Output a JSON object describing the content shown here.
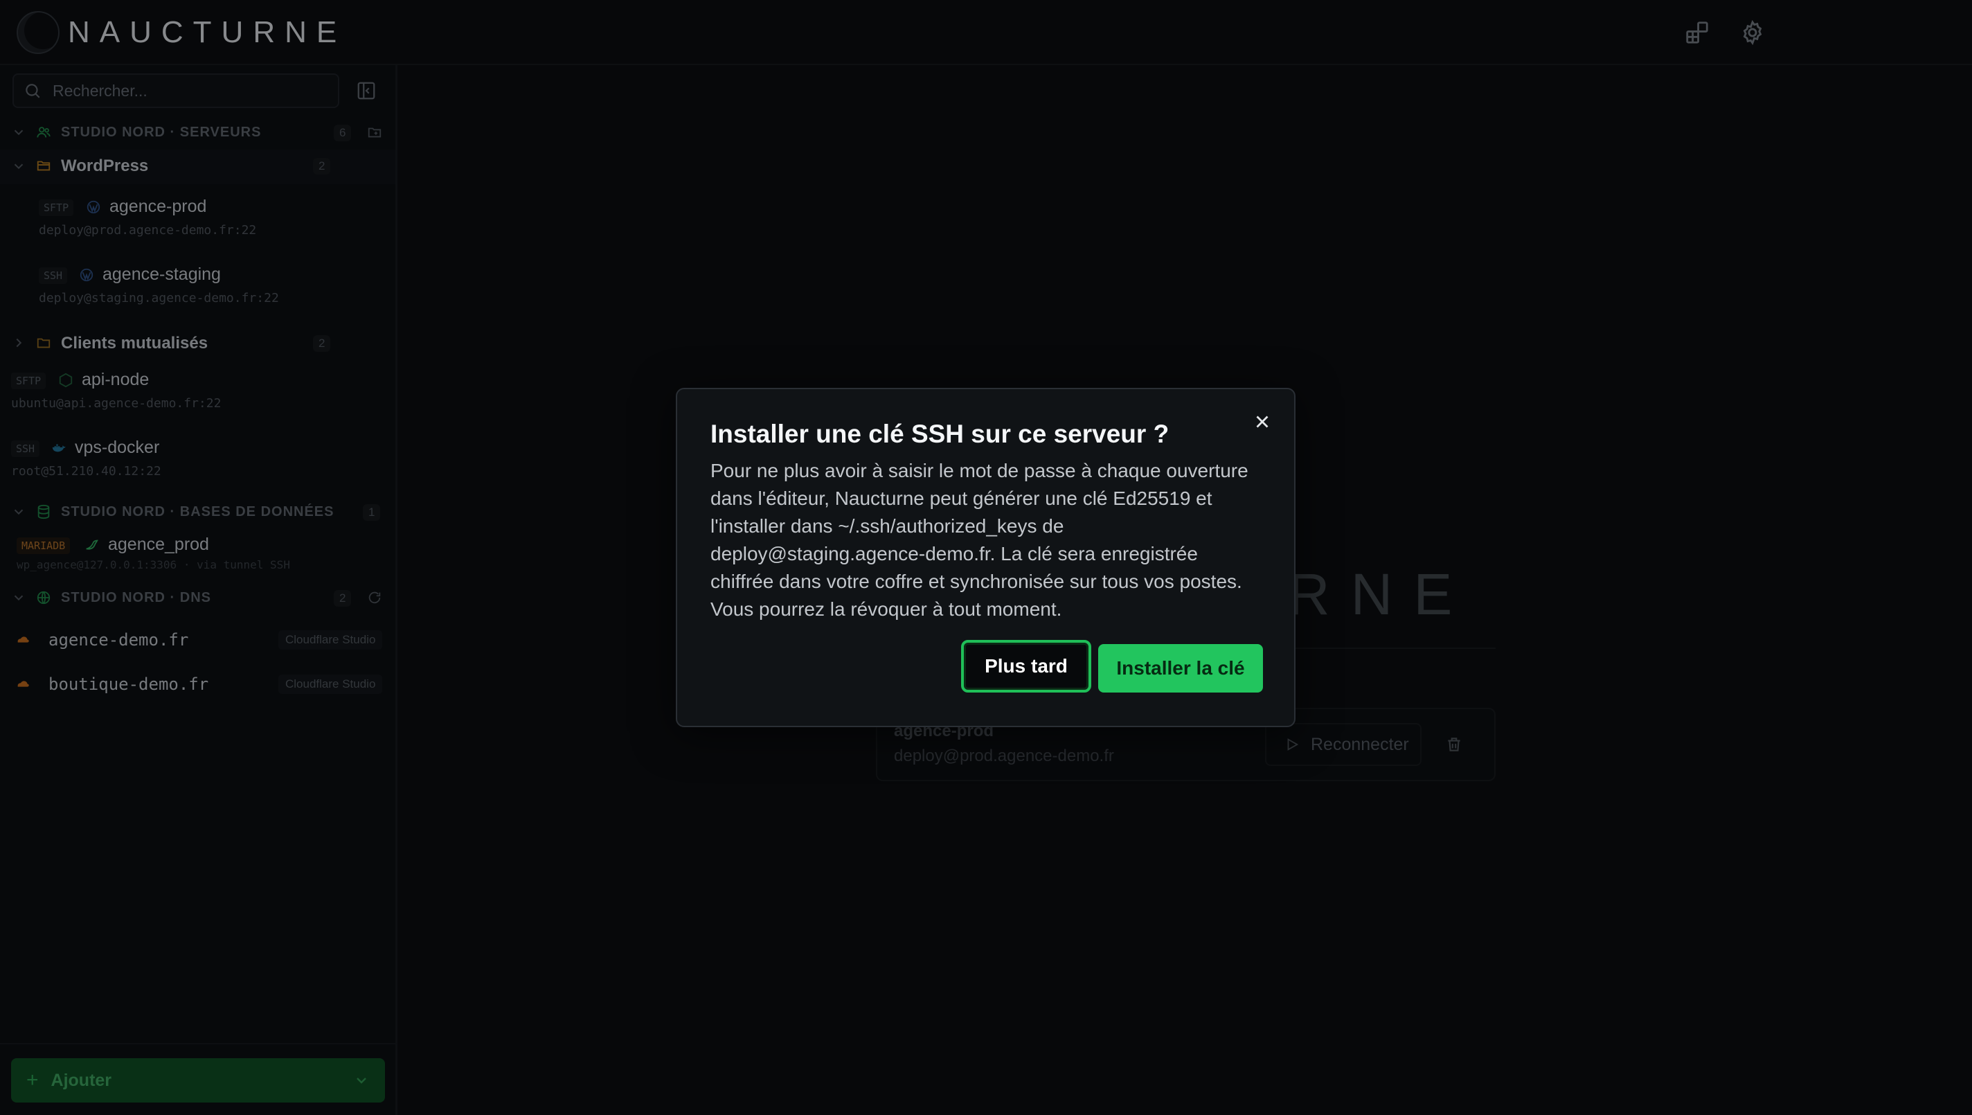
{
  "app": {
    "name": "NAUCTURNE",
    "accent": "#22c55e"
  },
  "header": {
    "logo_text": "NAUCTURNE",
    "icons": [
      "layout-icon",
      "gear-icon"
    ]
  },
  "sidebar": {
    "search_placeholder": "Rechercher...",
    "groups": [
      {
        "title": "STUDIO NORD · SERVEURS",
        "count": "6",
        "folders": [
          {
            "title": "WordPress",
            "count": "2",
            "servers": [
              {
                "proto": "SFTP",
                "name": "agence-prod",
                "sub": "deploy@prod.agence-demo.fr:22"
              },
              {
                "proto": "SSH",
                "name": "agence-staging",
                "sub": "deploy@staging.agence-demo.fr:22"
              }
            ]
          },
          {
            "title": "Clients mutualisés",
            "count": "2",
            "servers": []
          }
        ],
        "servers": [
          {
            "proto": "SFTP",
            "name": "api-node",
            "sub": "ubuntu@api.agence-demo.fr:22"
          },
          {
            "proto": "SSH",
            "name": "vps-docker",
            "sub": "root@51.210.40.12:22"
          }
        ]
      },
      {
        "title": "STUDIO NORD · BASES DE DONNÉES",
        "count": "1",
        "servers": [
          {
            "proto": "MARIADB",
            "name": "agence_prod",
            "sub": "wp_agence@127.0.0.1:3306 · via tunnel SSH"
          }
        ]
      },
      {
        "title": "STUDIO NORD · DNS",
        "count": "2",
        "domains": [
          {
            "name": "agence-demo.fr",
            "provider": "Cloudflare Studio"
          },
          {
            "name": "boutique-demo.fr",
            "provider": "Cloudflare Studio"
          }
        ]
      }
    ],
    "add_label": "Ajouter"
  },
  "main": {
    "bg_logo": "RNE",
    "recent": {
      "title": "agence-prod",
      "sub": "deploy@prod.agence-demo.fr",
      "reconnect_label": "Reconnecter"
    }
  },
  "dialog": {
    "title": "Installer une clé SSH sur ce serveur ?",
    "body": "Pour ne plus avoir à saisir le mot de passe à chaque ouverture dans l'éditeur, Naucturne peut générer une clé Ed25519 et l'installer dans ~/.ssh/authorized_keys de deploy@staging.agence-demo.fr. La clé sera enregistrée chiffrée dans votre coffre et synchronisée sur tous vos postes. Vous pourrez la révoquer à tout moment.",
    "later_label": "Plus tard",
    "install_label": "Installer la clé"
  }
}
